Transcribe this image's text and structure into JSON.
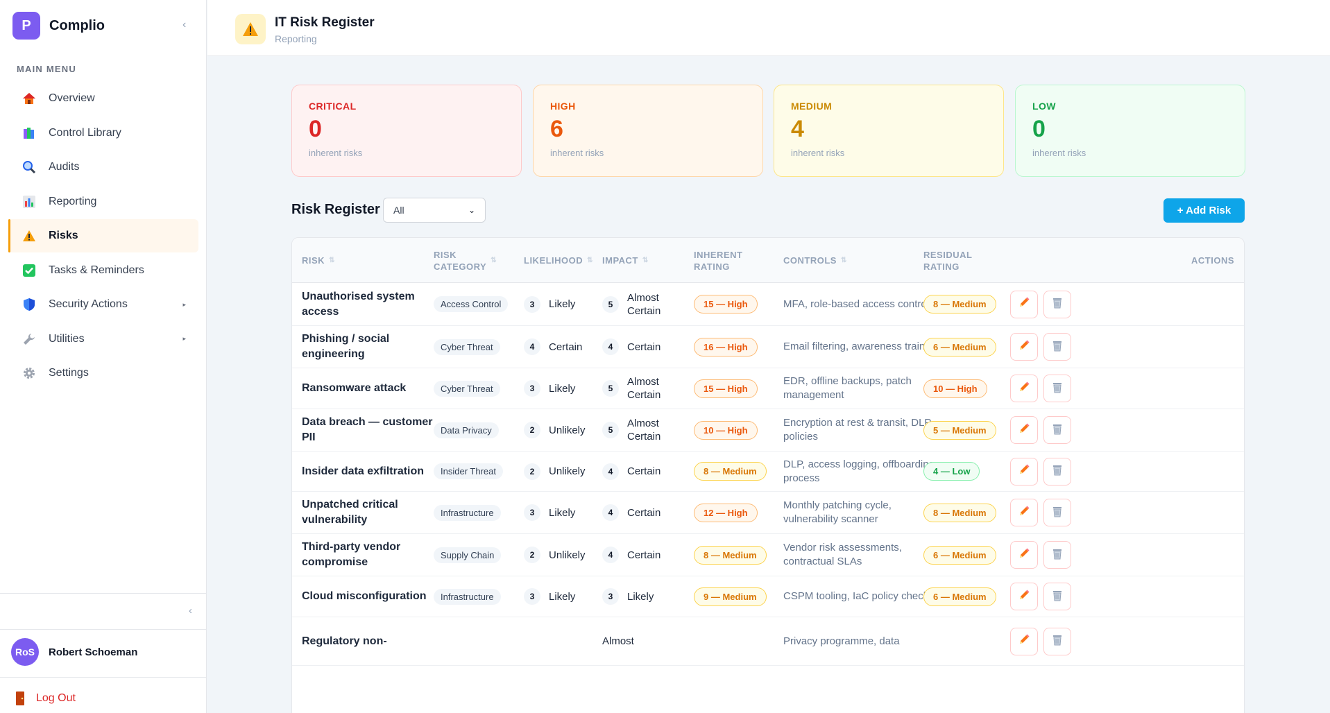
{
  "app": {
    "name": "Complio",
    "logo_letter": "P"
  },
  "sidebar": {
    "menu_heading": "MAIN MENU",
    "items": [
      {
        "label": "Overview",
        "icon": "house-icon"
      },
      {
        "label": "Control Library",
        "icon": "books-icon"
      },
      {
        "label": "Audits",
        "icon": "magnifier-icon"
      },
      {
        "label": "Reporting",
        "icon": "bar-chart-icon"
      },
      {
        "label": "Risks",
        "icon": "warning-icon",
        "active": true
      },
      {
        "label": "Tasks & Reminders",
        "icon": "checkbox-icon"
      },
      {
        "label": "Security Actions",
        "icon": "shield-icon",
        "has_submenu": true
      },
      {
        "label": "Utilities",
        "icon": "wrench-icon",
        "has_submenu": true
      },
      {
        "label": "Settings",
        "icon": "gear-icon"
      }
    ],
    "user": {
      "initials": "RoS",
      "name": "Robert Schoeman"
    },
    "logout_label": "Log Out"
  },
  "header": {
    "title": "IT Risk Register",
    "subtitle": "Reporting",
    "icon": "warning-icon"
  },
  "stats": [
    {
      "label": "CRITICAL",
      "value": "0",
      "sub": "inherent risks"
    },
    {
      "label": "HIGH",
      "value": "6",
      "sub": "inherent risks"
    },
    {
      "label": "MEDIUM",
      "value": "4",
      "sub": "inherent risks"
    },
    {
      "label": "LOW",
      "value": "0",
      "sub": "inherent risks"
    }
  ],
  "register": {
    "title": "Risk Register",
    "filter_value": "All",
    "add_label": "+ Add Risk",
    "columns": [
      "RISK",
      "RISK CATEGORY",
      "LIKELIHOOD",
      "IMPACT",
      "INHERENT RATING",
      "CONTROLS",
      "RESIDUAL RATING",
      "ACTIONS"
    ],
    "rows": [
      {
        "risk": "Unauthorised system access",
        "category": "Access Control",
        "likelihood_num": "3",
        "likelihood": "Likely",
        "impact_num": "5",
        "impact": "Almost Certain",
        "inherent": "15 — High",
        "inherent_level": "high",
        "controls": "MFA, role-based access control",
        "residual": "8 — Medium",
        "residual_level": "medium"
      },
      {
        "risk": "Phishing / social engineering",
        "category": "Cyber Threat",
        "likelihood_num": "4",
        "likelihood": "Certain",
        "impact_num": "4",
        "impact": "Certain",
        "inherent": "16 — High",
        "inherent_level": "high",
        "controls": "Email filtering, awareness training",
        "residual": "6 — Medium",
        "residual_level": "medium"
      },
      {
        "risk": "Ransomware attack",
        "category": "Cyber Threat",
        "likelihood_num": "3",
        "likelihood": "Likely",
        "impact_num": "5",
        "impact": "Almost Certain",
        "inherent": "15 — High",
        "inherent_level": "high",
        "controls": "EDR, offline backups, patch management",
        "residual": "10 — High",
        "residual_level": "high"
      },
      {
        "risk": "Data breach — customer PII",
        "category": "Data Privacy",
        "likelihood_num": "2",
        "likelihood": "Unlikely",
        "impact_num": "5",
        "impact": "Almost Certain",
        "inherent": "10 — High",
        "inherent_level": "high",
        "controls": "Encryption at rest & transit, DLP policies",
        "residual": "5 — Medium",
        "residual_level": "medium"
      },
      {
        "risk": "Insider data exfiltration",
        "category": "Insider Threat",
        "likelihood_num": "2",
        "likelihood": "Unlikely",
        "impact_num": "4",
        "impact": "Certain",
        "inherent": "8 — Medium",
        "inherent_level": "medium",
        "controls": "DLP, access logging, offboarding process",
        "residual": "4 — Low",
        "residual_level": "low"
      },
      {
        "risk": "Unpatched critical vulnerability",
        "category": "Infrastructure",
        "likelihood_num": "3",
        "likelihood": "Likely",
        "impact_num": "4",
        "impact": "Certain",
        "inherent": "12 — High",
        "inherent_level": "high",
        "controls": "Monthly patching cycle, vulnerability scanner",
        "residual": "8 — Medium",
        "residual_level": "medium"
      },
      {
        "risk": "Third-party vendor compromise",
        "category": "Supply Chain",
        "likelihood_num": "2",
        "likelihood": "Unlikely",
        "impact_num": "4",
        "impact": "Certain",
        "inherent": "8 — Medium",
        "inherent_level": "medium",
        "controls": "Vendor risk assessments, contractual SLAs",
        "residual": "6 — Medium",
        "residual_level": "medium"
      },
      {
        "risk": "Cloud misconfiguration",
        "category": "Infrastructure",
        "likelihood_num": "3",
        "likelihood": "Likely",
        "impact_num": "3",
        "impact": "Likely",
        "inherent": "9 — Medium",
        "inherent_level": "medium",
        "controls": "CSPM tooling, IaC policy checks",
        "residual": "6 — Medium",
        "residual_level": "medium"
      },
      {
        "risk": "Regulatory non-",
        "category": "",
        "likelihood_num": "",
        "likelihood": "",
        "impact_num": "",
        "impact": "Almost",
        "inherent": "",
        "inherent_level": "high",
        "controls": "Privacy programme, data",
        "residual": "",
        "residual_level": "low"
      }
    ]
  },
  "colors": {
    "brand": "#7c5cf0",
    "accent": "#0ea5e9",
    "critical": "#dc2626",
    "high": "#ea580c",
    "medium": "#ca8a04",
    "low": "#16a34a"
  }
}
